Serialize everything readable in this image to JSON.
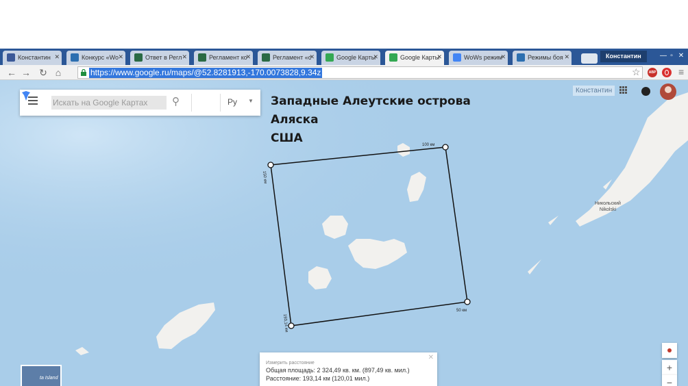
{
  "browser": {
    "tabs": [
      {
        "label": "Константин",
        "color": "#3b5998",
        "active": false
      },
      {
        "label": "Конкурс «Wo",
        "color": "#2c6fb0",
        "active": false
      },
      {
        "label": "Ответ в Регл",
        "color": "#2a6a44",
        "active": false
      },
      {
        "label": "Регламент ко",
        "color": "#2a6a44",
        "active": false
      },
      {
        "label": "Регламент «с",
        "color": "#2a6a44",
        "active": false
      },
      {
        "label": "Google Карты",
        "color": "#34a853",
        "active": false
      },
      {
        "label": "Google Карты",
        "color": "#34a853",
        "active": true
      },
      {
        "label": "WoWs режим",
        "color": "#4285f4",
        "active": false
      },
      {
        "label": "Режимы боя",
        "color": "#2c6fb0",
        "active": false
      }
    ],
    "profile_name": "Константин",
    "url": "https://www.google.ru/maps/@52.8281913,-170.0073828,9.34z",
    "abp_label": "ABP"
  },
  "maps": {
    "search_placeholder": "Искать на Google Картах",
    "language": "Ру",
    "account_name": "Константин",
    "caption_line1": "Западные Алеутские острова",
    "caption_line2": "Аляска",
    "caption_line3": "США",
    "ruler": {
      "top_label": "100 км",
      "left_label": "150 км",
      "right_label": "50 км",
      "bottom_label": "193,14 км"
    },
    "place": {
      "ru": "Никольский",
      "en": "Nikolski"
    },
    "mini_map_label": "ta Island",
    "measure": {
      "title": "Измерить расстояние",
      "area": "Общая площадь: 2 324,49 кв. км. (897,49 кв. мил.)",
      "distance": "Расстояние: 193,14 км (120,01 мил.)"
    }
  },
  "colors": {
    "water": "#a9cde9",
    "land": "#f2f1ee",
    "url_highlight": "#3377dd",
    "tab_strip": "#2b5797"
  }
}
